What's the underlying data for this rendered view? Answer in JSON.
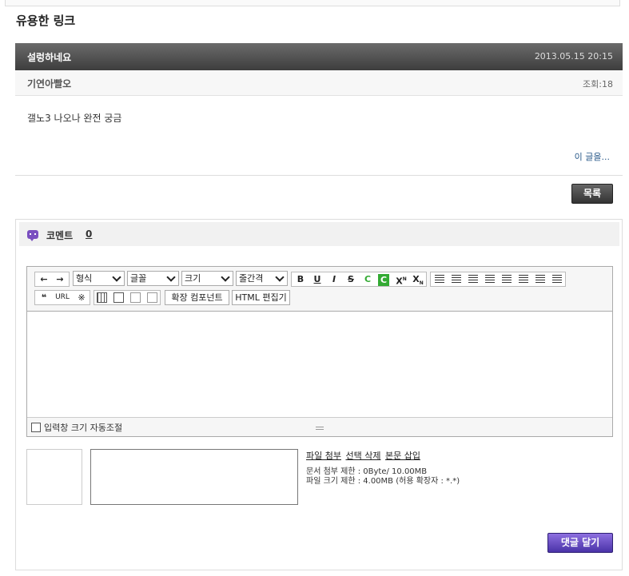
{
  "board": {
    "title": "유용한 링크"
  },
  "post": {
    "title": "설렁하네요",
    "date": "2013.05.15 20:15",
    "author": "기연아빨오",
    "views": "조회:18",
    "body": "갤노3 나오나 완전 궁금",
    "more_link": "이 글을..."
  },
  "buttons": {
    "list": "목록",
    "submit": "댓글 달기"
  },
  "comments": {
    "label": "코멘트",
    "count": "0"
  },
  "editor": {
    "undo_icon": "←",
    "redo_icon": "→",
    "format_select": "형식",
    "font_select": "글꼴",
    "size_select": "크기",
    "line_height_select": "줄간격",
    "bold": "B",
    "underline": "U",
    "italic": "I",
    "strike": "S",
    "font_color": "C",
    "bg_color": "C",
    "superscript": "X",
    "sup_mark": "N",
    "subscript": "X",
    "sub_mark": "N",
    "quote_icon": "❝",
    "url": "URL",
    "special_char": "※",
    "ext_component": "확장 컴포넌트",
    "html_editor": "HTML 편집기",
    "autosize_label": "입력창 크기 자동조절"
  },
  "file": {
    "actions": [
      "파일 첨부",
      "선택 삭제",
      "본문 삽입"
    ],
    "doc_limit": "문서 첨부 제한 : 0Byte/ 10.00MB",
    "file_limit": "파일 크기 제한 : 4.00MB (허용 확장자 : *.*)"
  },
  "colors": {
    "submit": "#5b3fbf",
    "header": "#4a4a4a",
    "icon_comment": "#7a4fc0"
  }
}
